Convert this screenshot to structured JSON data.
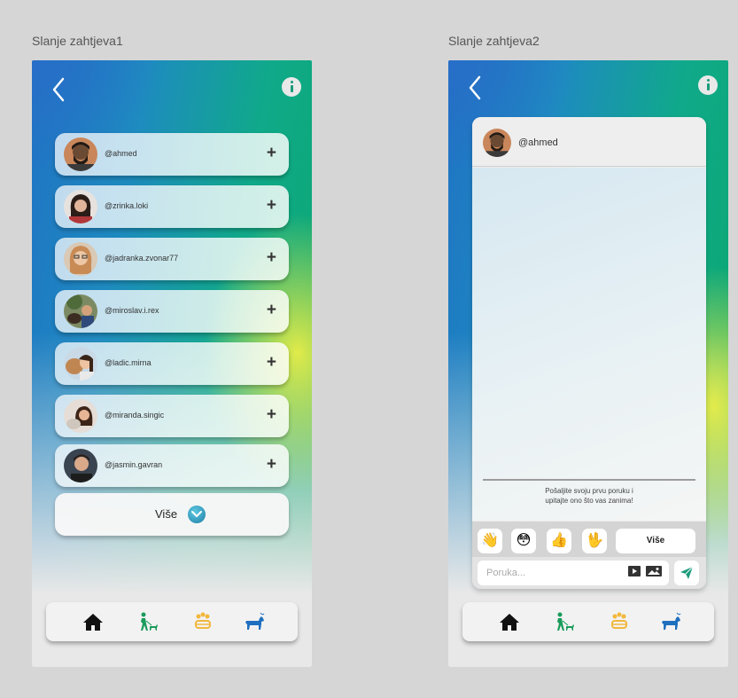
{
  "frames": {
    "left_title": "Slanje zahtjeva1",
    "right_title": "Slanje zahtjeva2"
  },
  "screen1": {
    "users": [
      {
        "username": "@ahmed",
        "action": "+"
      },
      {
        "username": "@zrinka.loki",
        "action": "+"
      },
      {
        "username": "@jadranka.zvonar77",
        "action": "+"
      },
      {
        "username": "@miroslav.i.rex",
        "action": "+"
      },
      {
        "username": "@ladic.mirna",
        "action": "+"
      },
      {
        "username": "@miranda.singic",
        "action": "+"
      },
      {
        "username": "@jasmin.gavran",
        "action": "+"
      }
    ],
    "more_label": "Više"
  },
  "screen2": {
    "chat_user": "@ahmed",
    "hint_line1": "Pošaljite svoju prvu poruku i",
    "hint_line2": "upitajte ono što vas zanima!",
    "emojis": [
      "👋",
      "😳",
      "👍",
      "🖖"
    ],
    "more_label": "Više",
    "input_placeholder": "Poruka..."
  },
  "navbar": {
    "icons": [
      "home-icon",
      "person-walking-dog-icon",
      "paw-print-icon",
      "dog-icon"
    ],
    "colors": {
      "home": "#111111",
      "walker": "#1a9b5b",
      "paw": "#f2b73c",
      "dog": "#1f6fbf"
    }
  },
  "colors": {
    "accent_green": "#0aa868",
    "accent_blue": "#1f73c4",
    "accent_yellow": "#ebee46"
  }
}
